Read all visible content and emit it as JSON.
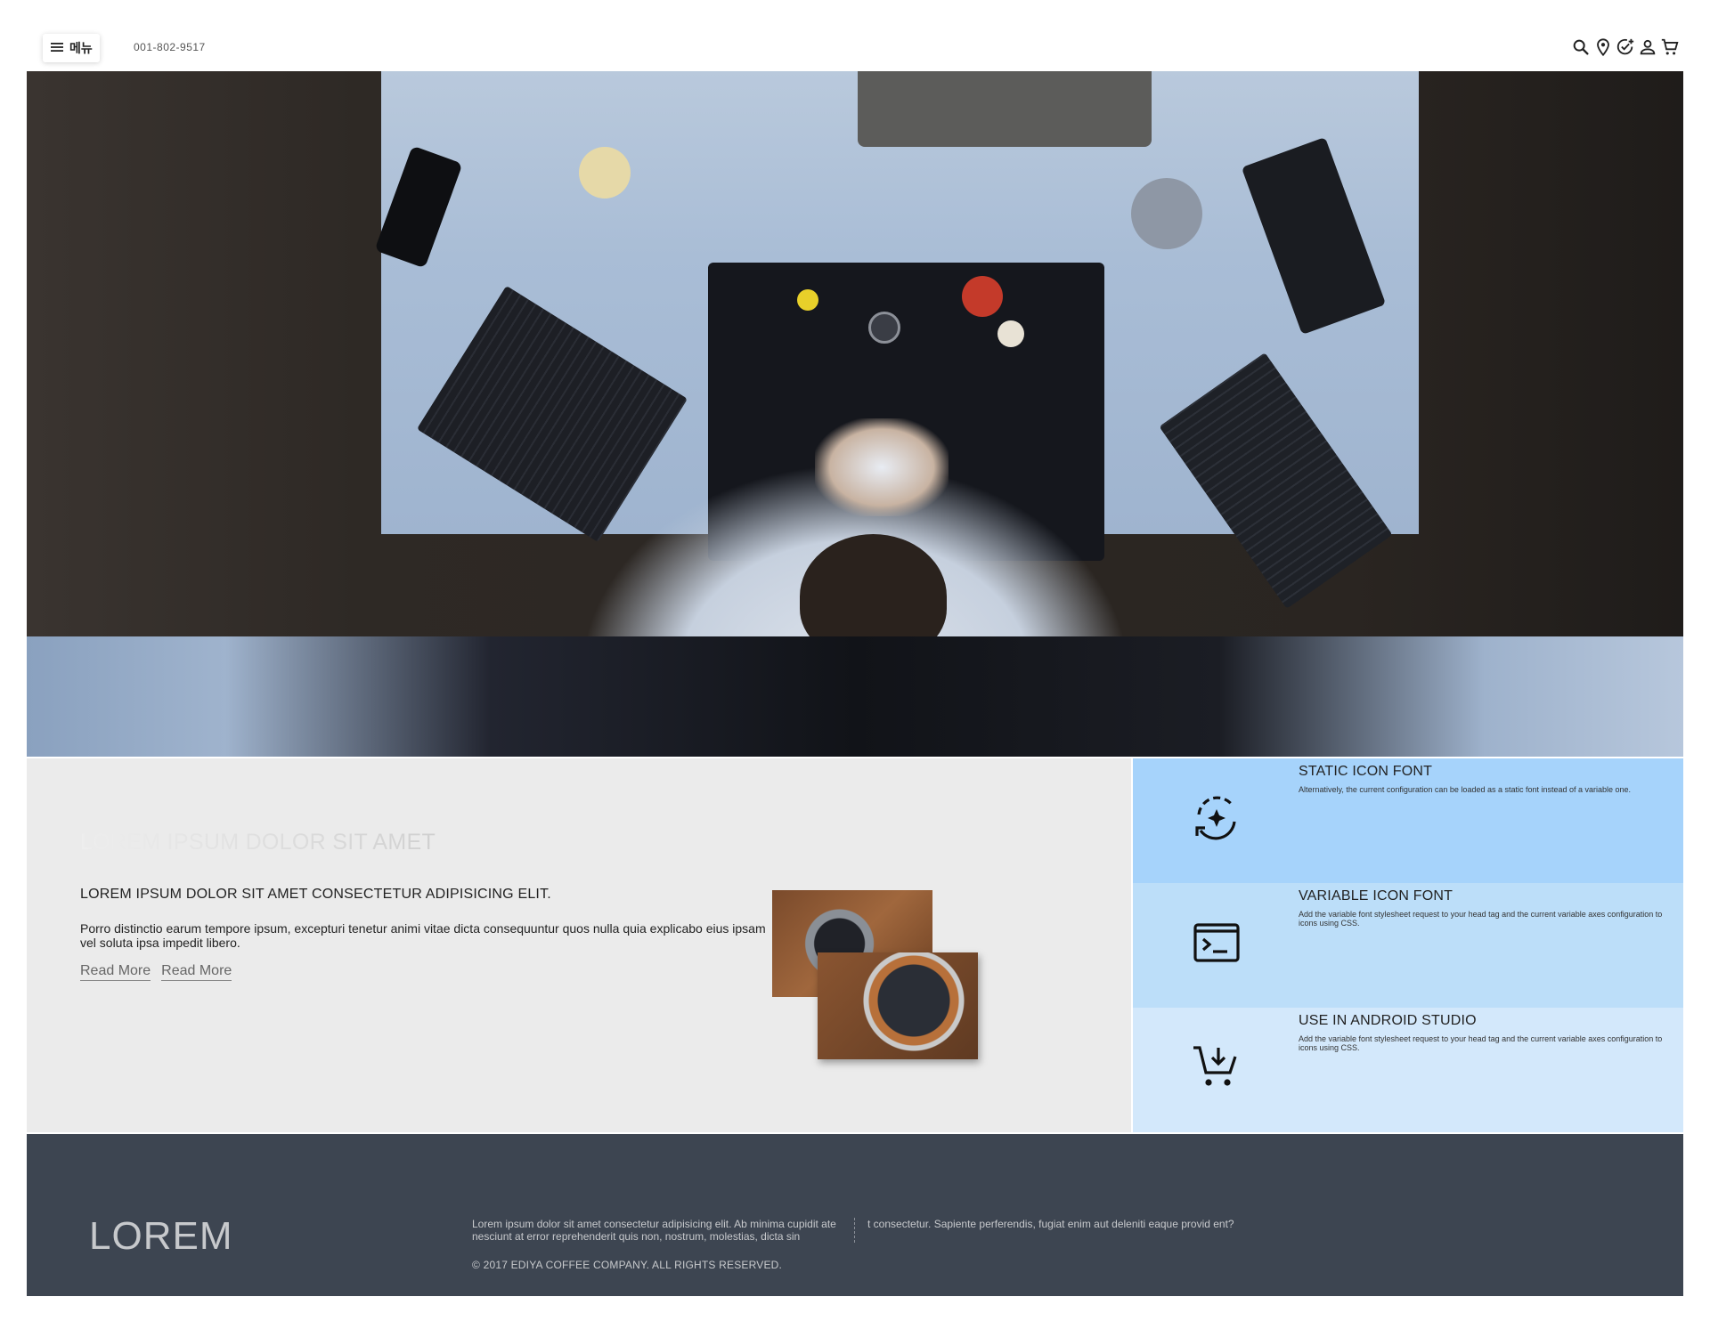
{
  "header": {
    "menu_label": "메뉴",
    "phone": "001-802-9517",
    "icons": [
      "search-icon",
      "location-pin-icon",
      "add-task-icon",
      "user-icon",
      "cart-icon"
    ]
  },
  "hero": {
    "image": "watchmaker-at-desk"
  },
  "content": {
    "faded_title": "LOREM IPSUM DOLOR SIT AMET",
    "subheading": "LOREM IPSUM DOLOR SIT AMET CONSECTETUR ADIPISICING ELIT.",
    "paragraph": "Porro distinctio earum tempore ipsum, excepturi tenetur animi vitae dicta consequuntur quos nulla quia explicabo eius ipsam vel soluta ipsa impedit libero.",
    "links": [
      "Read More",
      "Read More"
    ]
  },
  "features": [
    {
      "title": "STATIC ICON FONT",
      "desc": "Alternatively, the current configuration can be loaded as a static font instead of a variable one.",
      "icon": "sync-sparkle-icon",
      "bg": "#a6d3fb"
    },
    {
      "title": "VARIABLE ICON FONT",
      "desc": "Add the variable font stylesheet request to your head tag and the current variable axes configuration to icons using CSS.",
      "icon": "terminal-icon",
      "bg": "#bcdef9"
    },
    {
      "title": "USE IN ANDROID STUDIO",
      "desc": "Add the variable font stylesheet request to your head tag and the current variable axes configuration to icons using CSS.",
      "icon": "add-to-cart-icon",
      "bg": "#d3e8fb"
    }
  ],
  "footer": {
    "logo": "LOREM",
    "col1": "Lorem ipsum dolor sit amet consectetur adipisicing elit. Ab minima cupidit ate nesciunt at error reprehenderit quis non, nostrum, molestias, dicta sin",
    "col2": "t consectetur. Sapiente perferendis, fugiat enim aut deleniti eaque provid ent?",
    "copyright": "© 2017 EDIYA COFFEE COMPANY. ALL RIGHTS RESERVED.",
    "bg": "#3d4551"
  }
}
